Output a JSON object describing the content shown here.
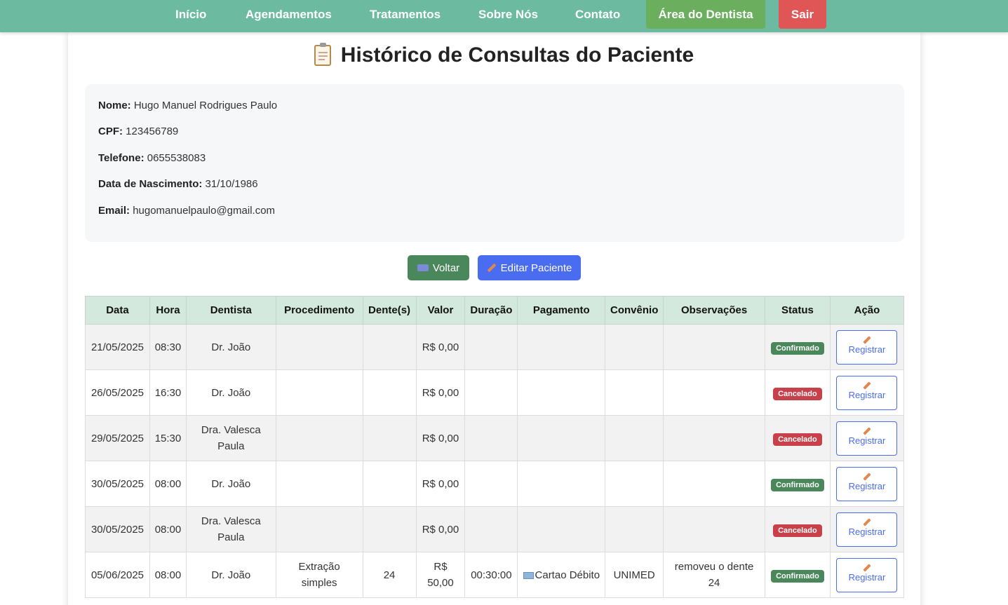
{
  "nav": {
    "links": [
      "Início",
      "Agendamentos",
      "Tratamentos",
      "Sobre Nós",
      "Contato"
    ],
    "dentist_area": "Área do Dentista",
    "logout": "Sair",
    "color_bg": "#6cbba0",
    "color_dentist": "#6aae5e",
    "color_logout": "#e05555"
  },
  "page": {
    "title": "Histórico de Consultas do Paciente",
    "title_icon": "clipboard-icon"
  },
  "patient": {
    "name_label": "Nome:",
    "name": "Hugo Manuel Rodrigues Paulo",
    "cpf_label": "CPF:",
    "cpf": "123456789",
    "phone_label": "Telefone:",
    "phone": "0655538083",
    "birth_label": "Data de Nascimento:",
    "birth": "31/10/1986",
    "email_label": "Email:",
    "email": "hugomanuelpaulo@gmail.com"
  },
  "actions": {
    "back": "Voltar",
    "edit": "Editar Paciente"
  },
  "table": {
    "headers": [
      "Data",
      "Hora",
      "Dentista",
      "Procedimento",
      "Dente(s)",
      "Valor",
      "Duração",
      "Pagamento",
      "Convênio",
      "Observações",
      "Status",
      "Ação"
    ],
    "action_label": "Registrar",
    "rows": [
      {
        "date": "21/05/2025",
        "time": "08:30",
        "dentist": "Dr. João",
        "procedure": "",
        "teeth": "",
        "value": "R$ 0,00",
        "duration": "",
        "payment": "",
        "insurance": "",
        "notes": "",
        "status": "Confirmado"
      },
      {
        "date": "26/05/2025",
        "time": "16:30",
        "dentist": "Dr. João",
        "procedure": "",
        "teeth": "",
        "value": "R$ 0,00",
        "duration": "",
        "payment": "",
        "insurance": "",
        "notes": "",
        "status": "Cancelado"
      },
      {
        "date": "29/05/2025",
        "time": "15:30",
        "dentist": "Dra. Valesca Paula",
        "procedure": "",
        "teeth": "",
        "value": "R$ 0,00",
        "duration": "",
        "payment": "",
        "insurance": "",
        "notes": "",
        "status": "Cancelado"
      },
      {
        "date": "30/05/2025",
        "time": "08:00",
        "dentist": "Dr. João",
        "procedure": "",
        "teeth": "",
        "value": "R$ 0,00",
        "duration": "",
        "payment": "",
        "insurance": "",
        "notes": "",
        "status": "Confirmado"
      },
      {
        "date": "30/05/2025",
        "time": "08:00",
        "dentist": "Dra. Valesca Paula",
        "procedure": "",
        "teeth": "",
        "value": "R$ 0,00",
        "duration": "",
        "payment": "",
        "insurance": "",
        "notes": "",
        "status": "Cancelado"
      },
      {
        "date": "05/06/2025",
        "time": "08:00",
        "dentist": "Dr. João",
        "procedure": "Extração simples",
        "teeth": "24",
        "value": "R$ 50,00",
        "duration": "00:30:00",
        "payment": "Cartao Débito",
        "insurance": "UNIMED",
        "notes": "removeu o dente 24",
        "status": "Confirmado"
      }
    ],
    "status_colors": {
      "Confirmado": "#4a875a",
      "Cancelado": "#c8404a"
    }
  }
}
